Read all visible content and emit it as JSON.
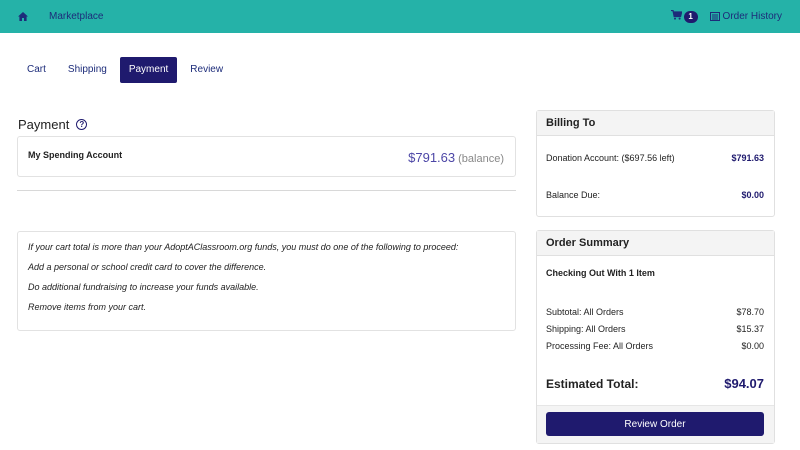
{
  "topbar": {
    "home_icon": "home-icon",
    "marketplace_label": "Marketplace",
    "cart_icon": "cart-icon",
    "cart_count": "1",
    "order_history_icon": "list-icon",
    "order_history_label": "Order History",
    "background": "#25b2a8"
  },
  "tabs": [
    {
      "label": "Cart",
      "active": false
    },
    {
      "label": "Shipping",
      "active": false
    },
    {
      "label": "Payment",
      "active": true
    },
    {
      "label": "Review",
      "active": false
    }
  ],
  "payment": {
    "title": "Payment",
    "help_icon": "question-circle-icon",
    "account_name": "My Spending Account",
    "account_amount": "$791.63",
    "account_note": "(balance)"
  },
  "info": {
    "lines": [
      "If your cart total is more than your AdoptAClassroom.org funds, you must do one of the following to proceed:",
      "Add a personal or school credit card to cover the difference.",
      "Do additional fundraising to increase your funds available.",
      "Remove items from your cart."
    ]
  },
  "billing": {
    "title": "Billing To",
    "donation_label": "Donation Account: ($697.56 left)",
    "donation_value": "$791.63",
    "balance_label": "Balance Due:",
    "balance_value": "$0.00"
  },
  "summary": {
    "title": "Order Summary",
    "checkout_text": "Checking Out With 1 Item",
    "rows": [
      {
        "label": "Subtotal: All Orders",
        "value": "$78.70"
      },
      {
        "label": "Shipping: All Orders",
        "value": "$15.37"
      },
      {
        "label": "Processing Fee: All Orders",
        "value": "$0.00"
      }
    ],
    "total_label": "Estimated Total:",
    "total_value": "$94.07",
    "review_button": "Review Order"
  },
  "colors": {
    "accent": "#1f1a6e",
    "teal": "#25b2a8"
  }
}
